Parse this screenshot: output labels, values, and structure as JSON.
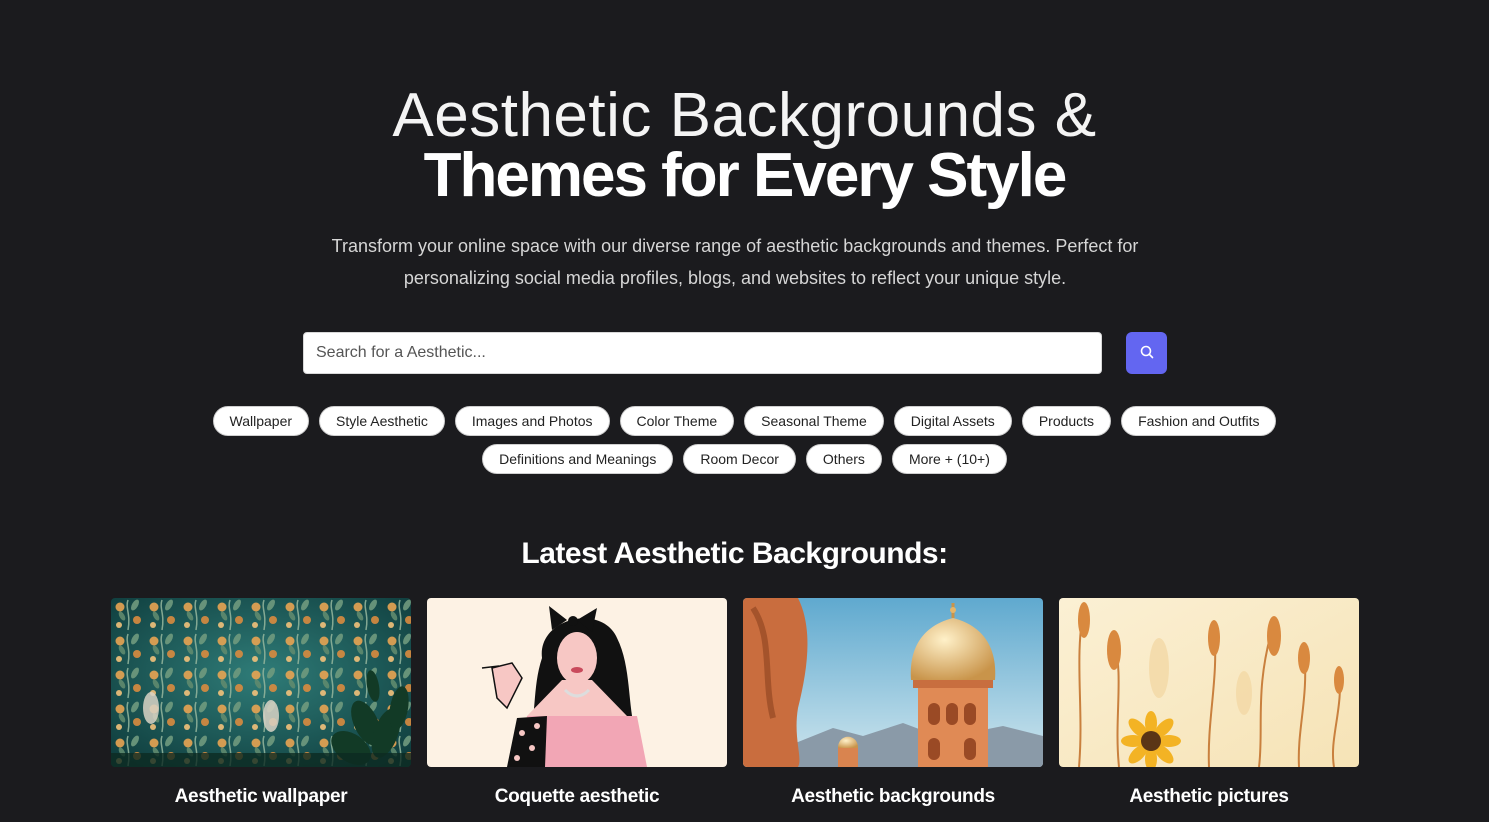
{
  "hero": {
    "title_line1": "Aesthetic Backgrounds &",
    "title_line2": "Themes for Every Style",
    "subtitle": "Transform your online space with our diverse range of aesthetic backgrounds and themes. Perfect for personalizing social media profiles, blogs, and websites to reflect your unique style."
  },
  "search": {
    "placeholder": "Search for a Aesthetic...",
    "value": "",
    "button_icon": "search-icon",
    "button_color": "#6366f1"
  },
  "categories": {
    "row1": [
      "Wallpaper",
      "Style Aesthetic",
      "Images and Photos",
      "Color Theme",
      "Seasonal Theme",
      "Digital Assets",
      "Products",
      "Fashion and Outfits"
    ],
    "row2": [
      "Definitions and Meanings",
      "Room Decor",
      "Others",
      "More + (10+)"
    ]
  },
  "latest": {
    "title": "Latest Aesthetic Backgrounds:",
    "cards": [
      {
        "caption": "Aesthetic wallpaper",
        "image": "teal floral wallpaper with plant"
      },
      {
        "caption": "Coquette aesthetic",
        "image": "illustrated woman with bow"
      },
      {
        "caption": "Aesthetic backgrounds",
        "image": "golden domed tower"
      },
      {
        "caption": "Aesthetic pictures",
        "image": "dried grass and sunflower"
      }
    ]
  },
  "colors": {
    "background": "#1b1b1e",
    "accent": "#6366f1"
  }
}
